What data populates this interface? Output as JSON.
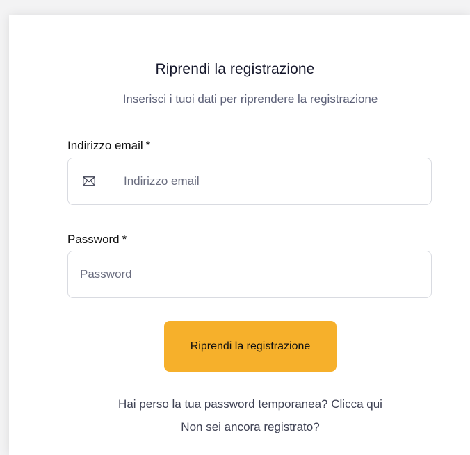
{
  "page": {
    "title": "Riprendi la registrazione",
    "subtitle": "Inserisci i tuoi dati per riprendere la registrazione"
  },
  "email": {
    "label": "Indirizzo email",
    "required_mark": "*",
    "placeholder": "Indirizzo email",
    "value": "",
    "icon": "envelope-icon"
  },
  "password": {
    "label": "Password",
    "required_mark": "*",
    "placeholder": "Password",
    "value": ""
  },
  "submit": {
    "label": "Riprendi la registrazione",
    "color": "#f6b02b"
  },
  "links": {
    "lost_password_text": "Hai perso la tua password temporanea?",
    "lost_password_link": "Clicca qui",
    "not_registered": "Non sei ancora registrato?"
  }
}
